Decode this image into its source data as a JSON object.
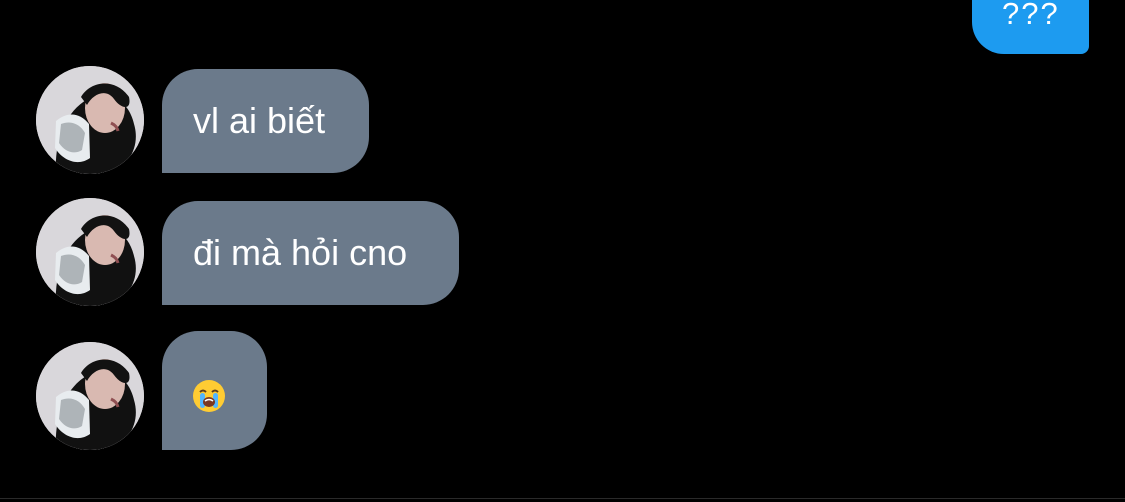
{
  "conversation": {
    "outgoing_message": {
      "text": "???"
    },
    "incoming_messages": [
      {
        "text": "vl ai biết",
        "avatar_icon": "profile-photo-icon"
      },
      {
        "text": "đi mà hỏi cno",
        "avatar_icon": "profile-photo-icon"
      },
      {
        "text": "",
        "emoji_icon": "loudly-crying-face-icon",
        "avatar_icon": "profile-photo-icon"
      }
    ],
    "colors": {
      "background": "#000000",
      "outgoing_bubble": "#1d9bf0",
      "incoming_bubble": "#6b7a8b",
      "text": "#ffffff"
    }
  }
}
